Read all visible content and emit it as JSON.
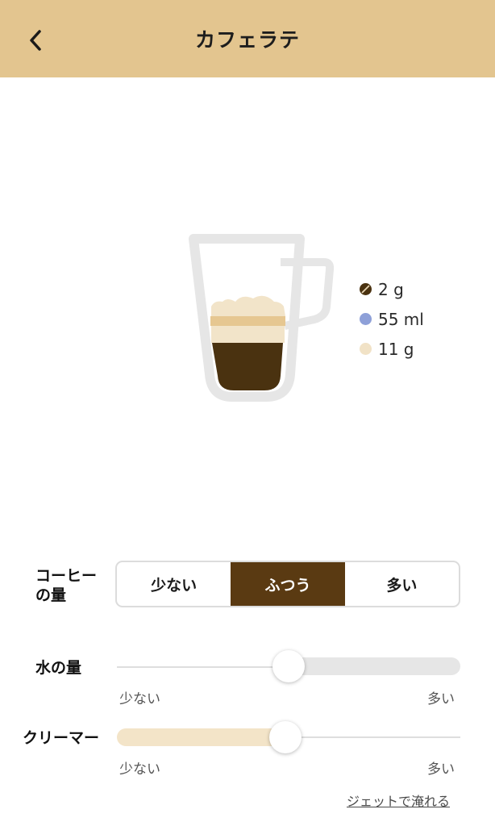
{
  "header": {
    "title": "カフェラテ",
    "back_icon": "chevron-left-icon",
    "background": "#e3c58f"
  },
  "recipe": {
    "items": [
      {
        "icon": "coffee-bean-icon",
        "color": "#4a3210",
        "text": "2 g"
      },
      {
        "icon": "water-dot-icon",
        "color": "#8ea0d8",
        "text": "55 ml"
      },
      {
        "icon": "creamer-dot-icon",
        "color": "#f1e2c6",
        "text": "11 g"
      }
    ]
  },
  "coffee_amount": {
    "label_line1": "コーヒー",
    "label_line2": "の量",
    "options": [
      "少ない",
      "ふつう",
      "多い"
    ],
    "selected": "ふつう",
    "accent": "#5a3a12"
  },
  "water_amount": {
    "label": "水の量",
    "min_label": "少ない",
    "max_label": "多い",
    "level": 0.5
  },
  "creamer_amount": {
    "label": "クリーマー",
    "min_label": "少ない",
    "max_label": "多い",
    "level": 0.5,
    "fill_color": "#f3e4c8"
  },
  "footer": {
    "jet_link": "ジェットで淹れる"
  }
}
